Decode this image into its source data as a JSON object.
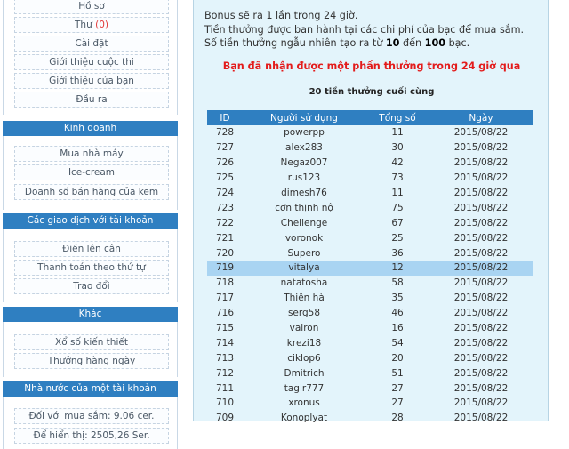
{
  "sidebar": {
    "profile_items": [
      {
        "label": "Hồ sơ"
      },
      {
        "label": "Thư",
        "count": "(0)"
      },
      {
        "label": "Cài đặt"
      },
      {
        "label": "Giới thiệu cuộc thi"
      },
      {
        "label": "Giới thiệu của bạn"
      },
      {
        "label": "Đầu ra"
      }
    ],
    "sections": [
      {
        "title": "Kinh doanh",
        "items": [
          "Mua nhà máy",
          "Ice-cream",
          "Doanh số bán hàng của kem"
        ]
      },
      {
        "title": "Các giao dịch với tài khoản",
        "items": [
          "Điền lên cân",
          "Thanh toán theo thứ tự",
          "Trao đổi"
        ]
      },
      {
        "title": "Khác",
        "items": [
          "Xổ số kiến thiết",
          "Thưởng hàng ngày"
        ]
      },
      {
        "title": "Nhà nước của một tài khoản",
        "items": [
          "Đối với mua sắm: 9.06 cer.",
          "Để hiển thị: 2505,26 Ser."
        ]
      }
    ]
  },
  "main": {
    "info": {
      "line1": "Bonus sẽ ra 1 lần trong 24 giờ.",
      "line2": "Tiền thưởng được ban hành tại các chi phí của bạc để mua sắm.",
      "line3_prefix": "Số tiền thưởng ngẫu nhiên tạo ra từ ",
      "line3_min": "10",
      "line3_mid": " đến ",
      "line3_max": "100",
      "line3_suffix": " bạc."
    },
    "notice": "Bạn đã nhận được một phần thưởng trong 24 giờ qua",
    "table_title": "20 tiền thưởng cuối cùng",
    "table": {
      "headers": [
        "ID",
        "Người sử dụng",
        "Tổng số",
        "Ngày"
      ],
      "highlight_id": "719",
      "rows": [
        [
          "728",
          "powerpp",
          "11",
          "2015/08/22"
        ],
        [
          "727",
          "alex283",
          "30",
          "2015/08/22"
        ],
        [
          "726",
          "Negaz007",
          "42",
          "2015/08/22"
        ],
        [
          "725",
          "rus123",
          "73",
          "2015/08/22"
        ],
        [
          "724",
          "dimesh76",
          "11",
          "2015/08/22"
        ],
        [
          "723",
          "cơn thịnh nộ",
          "75",
          "2015/08/22"
        ],
        [
          "722",
          "Chellenge",
          "67",
          "2015/08/22"
        ],
        [
          "721",
          "voronok",
          "25",
          "2015/08/22"
        ],
        [
          "720",
          "Supero",
          "36",
          "2015/08/22"
        ],
        [
          "719",
          "vitalya",
          "12",
          "2015/08/22"
        ],
        [
          "718",
          "natatosha",
          "58",
          "2015/08/22"
        ],
        [
          "717",
          "Thiên hà",
          "35",
          "2015/08/22"
        ],
        [
          "716",
          "serg58",
          "46",
          "2015/08/22"
        ],
        [
          "715",
          "valron",
          "16",
          "2015/08/22"
        ],
        [
          "714",
          "krezi18",
          "54",
          "2015/08/22"
        ],
        [
          "713",
          "ciklop6",
          "20",
          "2015/08/22"
        ],
        [
          "712",
          "Dmitrich",
          "51",
          "2015/08/22"
        ],
        [
          "711",
          "tagir777",
          "27",
          "2015/08/22"
        ],
        [
          "710",
          "xronus",
          "27",
          "2015/08/22"
        ],
        [
          "709",
          "Konoplyat",
          "28",
          "2015/08/22"
        ]
      ]
    }
  }
}
